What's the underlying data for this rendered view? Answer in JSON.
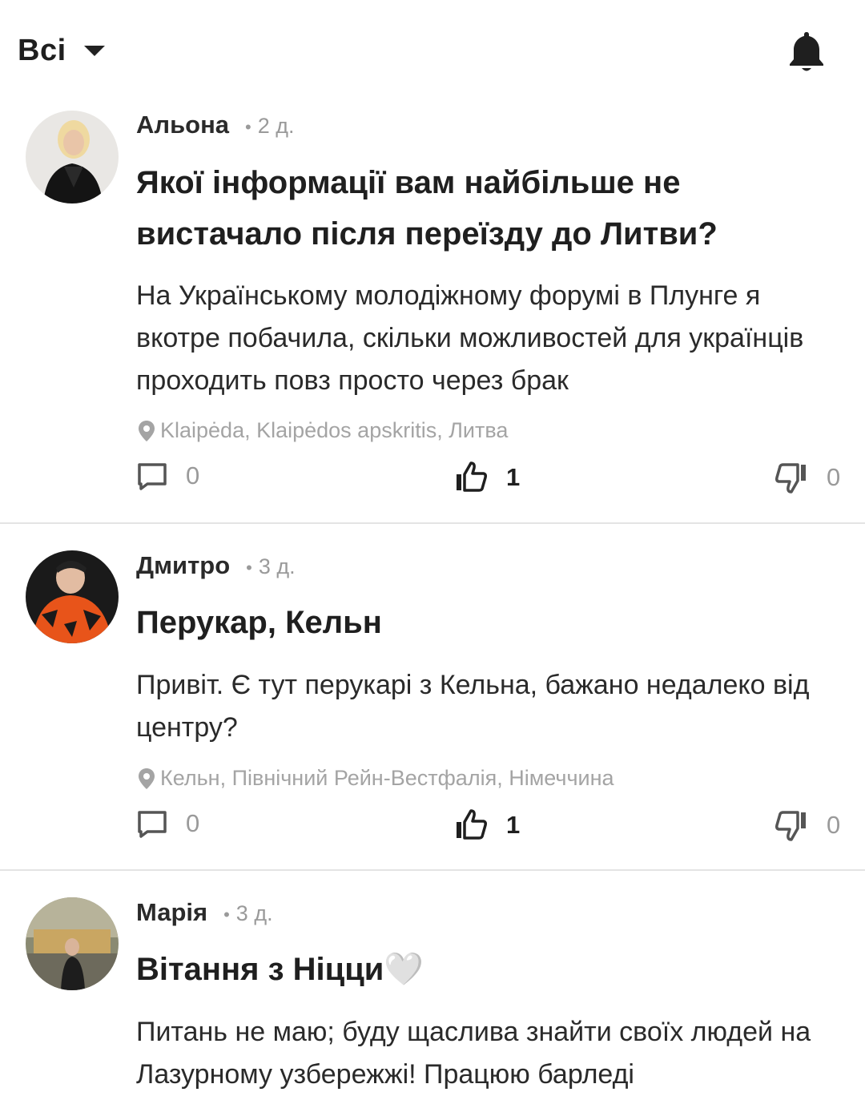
{
  "header": {
    "filter_label": "Всі"
  },
  "posts": [
    {
      "author": "Альона",
      "time": "2 д.",
      "title": "Якої інформації вам найбільше не вистачало після переїзду до Литви?",
      "body": "На Українському молодіжному форумі в Плунге я вкотре побачила, скільки можливостей для українців проходить повз просто через брак",
      "location": "Klaipėda, Klaipėdos apskritis, Литва",
      "comments": "0",
      "likes": "1",
      "dislikes": "0"
    },
    {
      "author": "Дмитро",
      "time": "3 д.",
      "title": "Перукар, Кельн",
      "body": "Привіт. Є тут перукарі з Кельна, бажано недалеко від центру?",
      "location": "Кельн, Північний Рейн-Вестфалія, Німеччина",
      "comments": "0",
      "likes": "1",
      "dislikes": "0"
    },
    {
      "author": "Марія",
      "time": "3 д.",
      "title": "Вітання з Ніцци",
      "title_emoji": "🤍",
      "body": "Питань не маю; буду щаслива знайти своїх людей на Лазурному узбережжі! Працюю барледі"
    }
  ]
}
